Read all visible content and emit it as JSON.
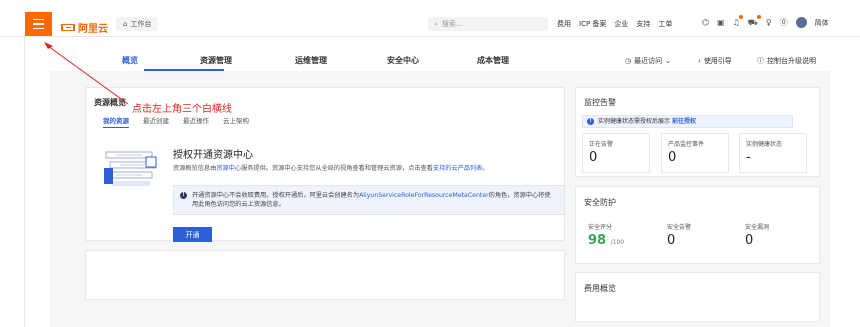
{
  "topbar": {
    "logo_text": "阿里云",
    "workbench": "工作台",
    "search_placeholder": "搜索...",
    "nav": [
      "费用",
      "ICP 备案",
      "企业",
      "支持",
      "工单"
    ],
    "brand": "简体"
  },
  "tabs": {
    "items": [
      "概览",
      "资源管理",
      "运维管理",
      "安全中心",
      "成本管理"
    ],
    "recent": "最近访问",
    "usage_guide": "使用引导",
    "upgrade_notes": "控制台升级说明"
  },
  "resource_overview": {
    "title": "资源概览",
    "tabs": [
      "我的资源",
      "最近创建",
      "最近操作",
      "云上架构"
    ],
    "heading": "授权开通资源中心",
    "desc_prefix": "资源概览信息由",
    "desc_link1": "资源中心",
    "desc_mid": "服务提供。资源中心支持您从全局的视角查看和管理云资源，点击查看",
    "desc_link2": "支持的云产品列表",
    "desc_suffix": "。",
    "notice_line1_a": "开通资源中心不会收取费用。授权开通后，阿里云会创建名为",
    "notice_line1_link": "AliyunServiceRoleForResourceMetaCenter",
    "notice_line1_b": "的角色，资源中心将使",
    "notice_line2": "用此角色访问您的云上资源信息。",
    "open_button": "开通"
  },
  "annotation": "点击左上角三个白横线",
  "monitoring": {
    "title": "监控告警",
    "alert_text": "实例健康状态需授权后展示",
    "alert_link": "前往授权",
    "stats": [
      {
        "label": "正在告警",
        "value": "0"
      },
      {
        "label": "产品监控事件",
        "value": "0"
      },
      {
        "label": "实例健康状态",
        "value": "-"
      }
    ]
  },
  "security": {
    "title": "安全防护",
    "stats": [
      {
        "label": "安全评分",
        "value": "98",
        "suffix": "/100"
      },
      {
        "label": "安全告警",
        "value": "0"
      },
      {
        "label": "安全漏洞",
        "value": "0"
      }
    ]
  },
  "cost": {
    "title": "费用概览"
  },
  "colors": {
    "accent": "#ff6a00",
    "primary": "#2d5fd6",
    "annotation": "#e0231f",
    "score": "#32a852"
  }
}
